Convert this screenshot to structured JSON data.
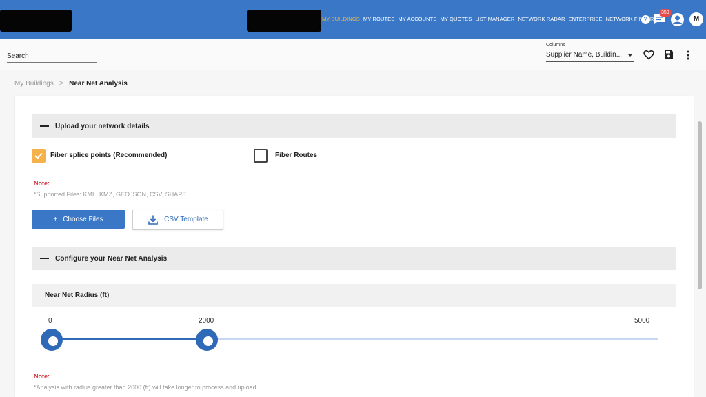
{
  "colors": {
    "brand_blue": "#3a78c7",
    "active_nav": "#f3b53f",
    "checkbox_checked": "#f5b24a",
    "note_red": "#d6333a",
    "slider_blue": "#2f6ab8"
  },
  "header": {
    "nav": [
      {
        "label": "MY BUILDINGS",
        "active": true
      },
      {
        "label": "MY ROUTES"
      },
      {
        "label": "MY ACCOUNTS"
      },
      {
        "label": "MY QUOTES"
      },
      {
        "label": "LIST MANAGER"
      },
      {
        "label": "NETWORK RADAR"
      },
      {
        "label": "ENTERPRISE"
      },
      {
        "label": "NETWORK FINDER"
      }
    ],
    "help_icon": "help-circle-icon",
    "messages_icon": "chat-icon",
    "messages_badge": "359",
    "user_icon": "account-circle-icon",
    "avatar_initial": "M"
  },
  "toolbar": {
    "search_placeholder": "Search",
    "columns_label": "Columns",
    "columns_value": "Supplier Name, Buildin...",
    "icons": [
      "heart-icon",
      "save-icon",
      "more-vertical-icon"
    ]
  },
  "breadcrumb": {
    "parent": "My Buildings",
    "separator": ">",
    "current": "Near Net Analysis"
  },
  "upload_section": {
    "title": "Upload your network details",
    "options": [
      {
        "label": "Fiber splice points (Recommended)",
        "checked": true
      },
      {
        "label": "Fiber Routes",
        "checked": false
      }
    ],
    "note_title": "Note:",
    "note_text": "*Supported Files: KML, KMZ, GEOJSON, CSV, SHAPE",
    "choose_files_label": "Choose Files",
    "choose_files_icon": "+",
    "csv_template_label": "CSV Template",
    "csv_template_icon": "download-icon"
  },
  "configure_section": {
    "title": "Configure your Near Net Analysis",
    "radius_label": "Near Net Radius (ft)",
    "slider": {
      "min": 0,
      "max": 5000,
      "value": 2000,
      "labels": [
        "0",
        "2000",
        "5000"
      ]
    },
    "note_title": "Note:",
    "note_text": "*Analysis with radius greater than 2000 (ft) will take longer to process and upload"
  }
}
